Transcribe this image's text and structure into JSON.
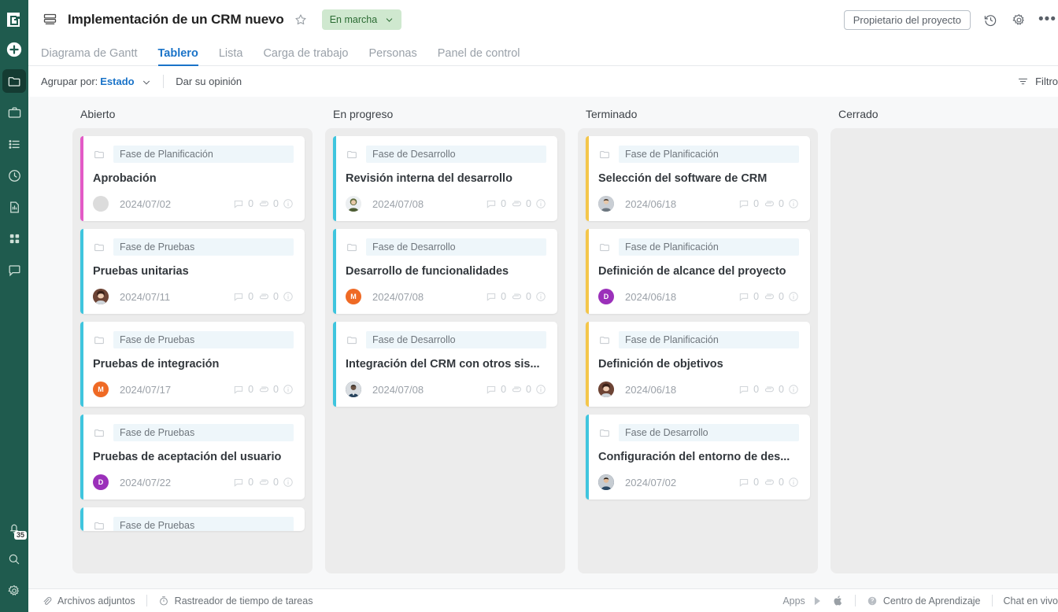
{
  "rail": {
    "logo": "brand-logo-g",
    "items": [
      {
        "name": "add-button",
        "icon": "plus-circle-icon"
      },
      {
        "name": "projects",
        "icon": "folder-icon",
        "active": true
      },
      {
        "name": "portfolio",
        "icon": "briefcase-icon"
      },
      {
        "name": "tasks-list",
        "icon": "list-icon"
      },
      {
        "name": "timesheets",
        "icon": "clock-icon"
      },
      {
        "name": "reports",
        "icon": "report-icon"
      },
      {
        "name": "apps-grid",
        "icon": "grid-icon"
      },
      {
        "name": "chat",
        "icon": "chat-bubble-icon"
      }
    ],
    "bottom": [
      {
        "name": "notifications",
        "icon": "bell-icon",
        "badge": "35"
      },
      {
        "name": "search",
        "icon": "search-icon"
      },
      {
        "name": "settings",
        "icon": "gear-icon"
      }
    ]
  },
  "header": {
    "project_icon": "project-stack-icon",
    "title": "Implementación de un CRM nuevo",
    "star_icon": "star-outline-icon",
    "status": "En marcha",
    "status_chevron": "chevron-down-icon",
    "owner_chip": "Propietario del proyecto",
    "history_icon": "history-clock-icon",
    "settings_icon": "gear-icon",
    "more_icon": "ellipsis-icon",
    "more_label": "•••"
  },
  "tabs": [
    {
      "label": "Diagrama de Gantt",
      "active": false
    },
    {
      "label": "Tablero",
      "active": true
    },
    {
      "label": "Lista",
      "active": false
    },
    {
      "label": "Carga de trabajo",
      "active": false
    },
    {
      "label": "Personas",
      "active": false
    },
    {
      "label": "Panel de control",
      "active": false
    }
  ],
  "toolbar": {
    "group_by_label": "Agrupar por:",
    "group_by_value": "Estado",
    "feedback": "Dar su opinión",
    "filter": "Filtro",
    "filter_icon": "filter-icon"
  },
  "colors": {
    "accent_blue": "#1a73c8",
    "rail_green": "#1f5b4e",
    "status_pill_bg": "#cfe8cf",
    "status_pill_text": "#2b6b33",
    "phase_chip_bg": "#eef6fa",
    "bar_magenta": "#e35ac6",
    "bar_cyan": "#3fc5de",
    "bar_amber": "#f4c64a"
  },
  "board": {
    "columns": [
      {
        "title": "Abierto",
        "cards": [
          {
            "bar": "#e35ac6",
            "phase": "Fase de Planificación",
            "title": "Aprobación",
            "date": "2024/07/02",
            "avatar": {
              "type": "empty",
              "initial": "",
              "bg": "#dcdcdc"
            },
            "comments": "0",
            "attachments": "0"
          },
          {
            "bar": "#3fc5de",
            "phase": "Fase de Pruebas",
            "title": "Pruebas unitarias",
            "date": "2024/07/11",
            "avatar": {
              "type": "photo",
              "initial": "",
              "bg": "#7a4b3a"
            },
            "comments": "0",
            "attachments": "0"
          },
          {
            "bar": "#3fc5de",
            "phase": "Fase de Pruebas",
            "title": "Pruebas de integración",
            "date": "2024/07/17",
            "avatar": {
              "type": "initial",
              "initial": "M",
              "bg": "#ef6a25"
            },
            "comments": "0",
            "attachments": "0"
          },
          {
            "bar": "#3fc5de",
            "phase": "Fase de Pruebas",
            "title": "Pruebas de aceptación del usuario",
            "date": "2024/07/22",
            "avatar": {
              "type": "initial",
              "initial": "D",
              "bg": "#9b30ba"
            },
            "comments": "0",
            "attachments": "0"
          },
          {
            "bar": "#3fc5de",
            "phase": "Fase de Pruebas",
            "title": "",
            "date": "",
            "avatar": {
              "type": "empty",
              "initial": "",
              "bg": "#dcdcdc"
            },
            "comments": "",
            "attachments": "",
            "partial": true
          }
        ]
      },
      {
        "title": "En progreso",
        "cards": [
          {
            "bar": "#3fc5de",
            "phase": "Fase de Desarrollo",
            "title": "Revisión interna del desarrollo",
            "date": "2024/07/08",
            "avatar": {
              "type": "photo",
              "initial": "",
              "bg": "#6b7f56"
            },
            "comments": "0",
            "attachments": "0"
          },
          {
            "bar": "#3fc5de",
            "phase": "Fase de Desarrollo",
            "title": "Desarrollo de funcionalidades",
            "date": "2024/07/08",
            "avatar": {
              "type": "initial",
              "initial": "M",
              "bg": "#ef6a25"
            },
            "comments": "0",
            "attachments": "0"
          },
          {
            "bar": "#3fc5de",
            "phase": "Fase de Desarrollo",
            "title": "Integración del CRM con otros sis...",
            "date": "2024/07/08",
            "avatar": {
              "type": "photo",
              "initial": "",
              "bg": "#53616f"
            },
            "comments": "0",
            "attachments": "0"
          }
        ]
      },
      {
        "title": "Terminado",
        "cards": [
          {
            "bar": "#f4c64a",
            "phase": "Fase de Planificación",
            "title": "Selección del software de CRM",
            "date": "2024/06/18",
            "avatar": {
              "type": "photo",
              "initial": "",
              "bg": "#9aa3ad"
            },
            "comments": "0",
            "attachments": "0"
          },
          {
            "bar": "#f4c64a",
            "phase": "Fase de Planificación",
            "title": "Definición de alcance del proyecto",
            "date": "2024/06/18",
            "avatar": {
              "type": "initial",
              "initial": "D",
              "bg": "#9b30ba"
            },
            "comments": "0",
            "attachments": "0"
          },
          {
            "bar": "#f4c64a",
            "phase": "Fase de Planificación",
            "title": "Definición de objetivos",
            "date": "2024/06/18",
            "avatar": {
              "type": "photo",
              "initial": "",
              "bg": "#7a4b3a"
            },
            "comments": "0",
            "attachments": "0"
          },
          {
            "bar": "#3fc5de",
            "phase": "Fase de Desarrollo",
            "title": "Configuración del entorno de des...",
            "date": "2024/07/02",
            "avatar": {
              "type": "photo",
              "initial": "",
              "bg": "#44566b"
            },
            "comments": "0",
            "attachments": "0"
          }
        ]
      },
      {
        "title": "Cerrado",
        "cards": []
      }
    ]
  },
  "footer": {
    "attachments": "Archivos adjuntos",
    "attachments_icon": "paperclip-icon",
    "time_tracker": "Rastreador de tiempo de tareas",
    "time_tracker_icon": "stopwatch-icon",
    "apps_label": "Apps",
    "play_icon": "google-play-icon",
    "apple_icon": "apple-icon",
    "help_icon": "question-circle-icon",
    "learning_center": "Centro de Aprendizaje",
    "live_chat": "Chat en vivo"
  }
}
